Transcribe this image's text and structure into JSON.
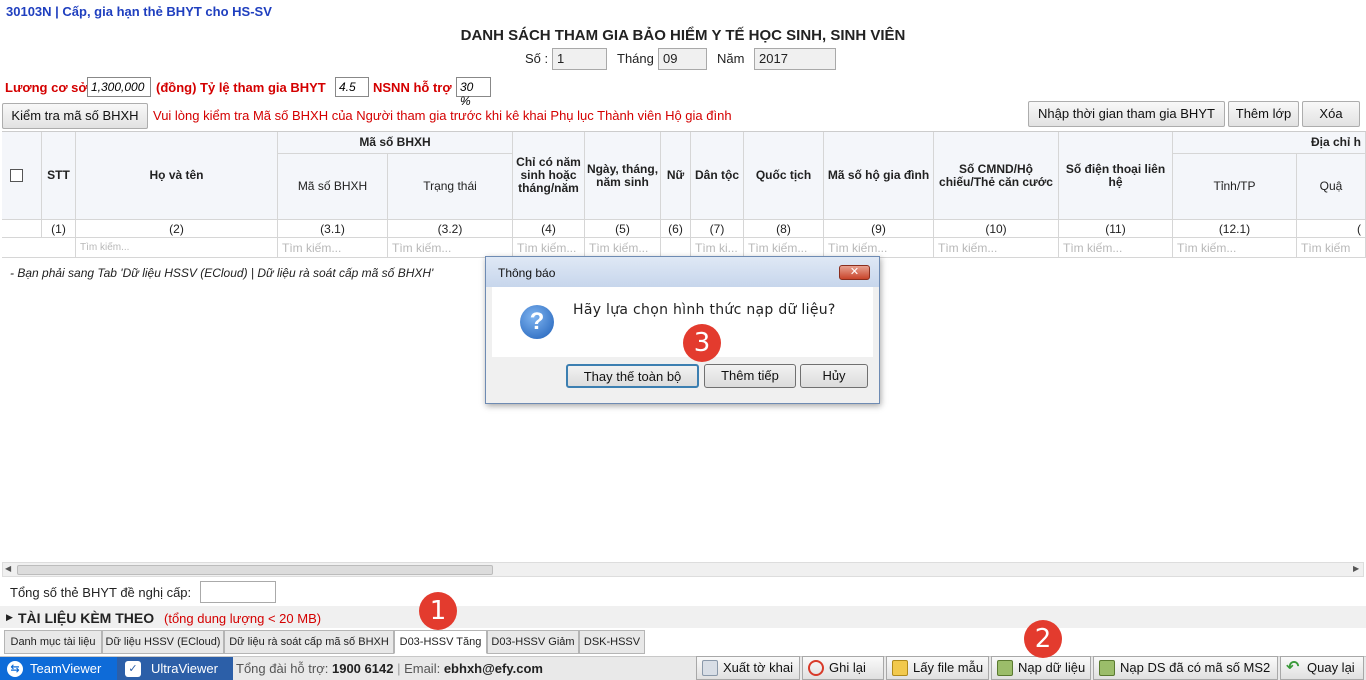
{
  "app_title": "30103N | Cấp, gia hạn thẻ BHYT cho HS-SV",
  "heading": "DANH SÁCH THAM GIA BẢO HIỂM Y TẾ HỌC SINH, SINH VIÊN",
  "form": {
    "so_label": "Số :",
    "so_value": "1",
    "thang_label": "Tháng",
    "thang_value": "09",
    "nam_label": "Năm",
    "nam_value": "2017",
    "luong_label": "Lương cơ sở",
    "luong_value": "1,300,000",
    "dong_label": "(đồng) Tỷ lệ tham gia BHYT",
    "tyle_value": "4.5",
    "nsnn_label": "NSNN hỗ trợ",
    "nsnn_value": "30 %"
  },
  "toolbar": {
    "check_bhxh": "Kiểm tra mã số BHXH",
    "notice": "Vui lòng kiểm tra Mã số BHXH của Người tham gia trước khi kê khai Phụ lục Thành viên Hộ gia đình",
    "import_time": "Nhập thời gian tham gia BHYT",
    "add_class": "Thêm lớp",
    "delete": "Xóa"
  },
  "grid": {
    "group_bhxh": "Mã số BHXH",
    "group_address": "Địa chỉ h",
    "headers": {
      "stt": "STT",
      "name": "Họ và tên",
      "ma_so": "Mã số BHXH",
      "trang_thai": "Trạng thái",
      "chi_co_nam": "Chỉ có năm sinh hoặc tháng/năm",
      "ngay_sinh": "Ngày, tháng, năm sinh",
      "nu": "Nữ",
      "dan_toc": "Dân tộc",
      "quoc_tich": "Quốc tịch",
      "ho_gd": "Mã số hộ gia đình",
      "cmnd": "Số CMND/Hộ chiếu/Thẻ căn cước",
      "sdt": "Số điện thoại liên hệ",
      "tinh": "Tỉnh/TP",
      "quan": "Quậ"
    },
    "numbers": [
      "(1)",
      "(2)",
      "(3.1)",
      "(3.2)",
      "(4)",
      "(5)",
      "(6)",
      "(7)",
      "(8)",
      "(9)",
      "(10)",
      "(11)",
      "(12.1)",
      "("
    ],
    "search_placeholder": "Tìm kiếm...",
    "search_short": "Tìm ki...",
    "search_placeholder_alt": "Tìm kiếm",
    "drop_message": "- Bạn phải sang Tab 'Dữ liệu HSSV (ECloud) | Dữ liệu rà soát cấp mã số BHXH'"
  },
  "footer": {
    "total_label": "Tổng số thẻ BHYT đề nghị cấp:",
    "attach_title": "TÀI LIỆU KÈM THEO",
    "attach_note": "(tổng dung lượng < 20 MB)",
    "tabs": [
      "Danh mục tài liệu",
      "Dữ liệu HSSV (ECloud)",
      "Dữ liệu rà soát cấp mã số BHXH",
      "D03-HSSV Tăng",
      "D03-HSSV Giảm",
      "DSK-HSSV"
    ],
    "active_tab": "D03-HSSV Tăng"
  },
  "bottom": {
    "teamviewer": "TeamViewer",
    "ultraviewer": "UltraViewer",
    "hotline_label": "Tổng đài hỗ trợ:",
    "hotline": "1900 6142",
    "email_label": "Email:",
    "email": "ebhxh@efy.com",
    "buttons": [
      "Xuất tờ khai",
      "Ghi lại",
      "Lấy file mẫu",
      "Nạp dữ liệu",
      "Nạp DS đã có mã số MS2",
      "Quay lại"
    ]
  },
  "dialog": {
    "title": "Thông báo",
    "close": "✕",
    "message": "Hãy lựa chọn hình thức nạp dữ liệu?",
    "buttons": [
      "Thay thế toàn bộ",
      "Thêm tiếp",
      "Hủy"
    ]
  },
  "markers": [
    "1",
    "2",
    "3"
  ]
}
